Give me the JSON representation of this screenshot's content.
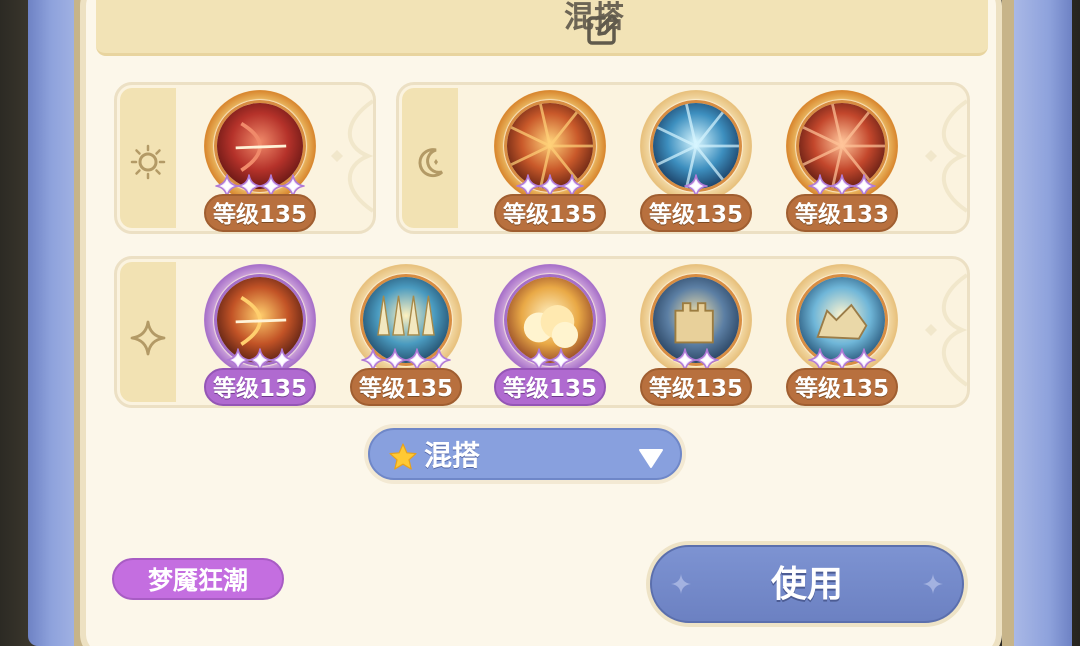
{
  "header": {
    "title": "混搭",
    "edit_icon": "edit-icon"
  },
  "colors": {
    "level_brown": "#b8703e",
    "level_purple": "#b06ad0",
    "button_blue": "#7d93d2",
    "tag_purple": "#c46ee0"
  },
  "sun_group": {
    "icon": "sun-icon",
    "skills": [
      {
        "level": "等级135",
        "stars": 4,
        "rarity": "orange",
        "theme": "archer"
      }
    ]
  },
  "moon_group": {
    "icon": "moon-icon",
    "skills": [
      {
        "level": "等级135",
        "stars": 3,
        "rarity": "orange",
        "theme": "burst"
      },
      {
        "level": "等级135",
        "stars": 1,
        "rarity": "gold",
        "theme": "beam"
      },
      {
        "level": "等级133",
        "stars": 3,
        "rarity": "orange",
        "theme": "slash"
      }
    ]
  },
  "star_group": {
    "icon": "sparkle-icon",
    "skills": [
      {
        "level": "等级135",
        "stars": 3,
        "rarity": "purple",
        "theme": "bow"
      },
      {
        "level": "等级135",
        "stars": 4,
        "rarity": "gold",
        "theme": "spikes"
      },
      {
        "level": "等级135",
        "stars": 2,
        "rarity": "purple",
        "theme": "cloud"
      },
      {
        "level": "等级135",
        "stars": 2,
        "rarity": "gold",
        "theme": "fortress"
      },
      {
        "level": "等级135",
        "stars": 3,
        "rarity": "gold",
        "theme": "wolf"
      }
    ]
  },
  "dropdown": {
    "label": "混搭",
    "icon": "star-icon",
    "arrow": "triangle-down-icon"
  },
  "tag": {
    "label": "梦魇狂潮"
  },
  "use_button": {
    "label": "使用"
  }
}
